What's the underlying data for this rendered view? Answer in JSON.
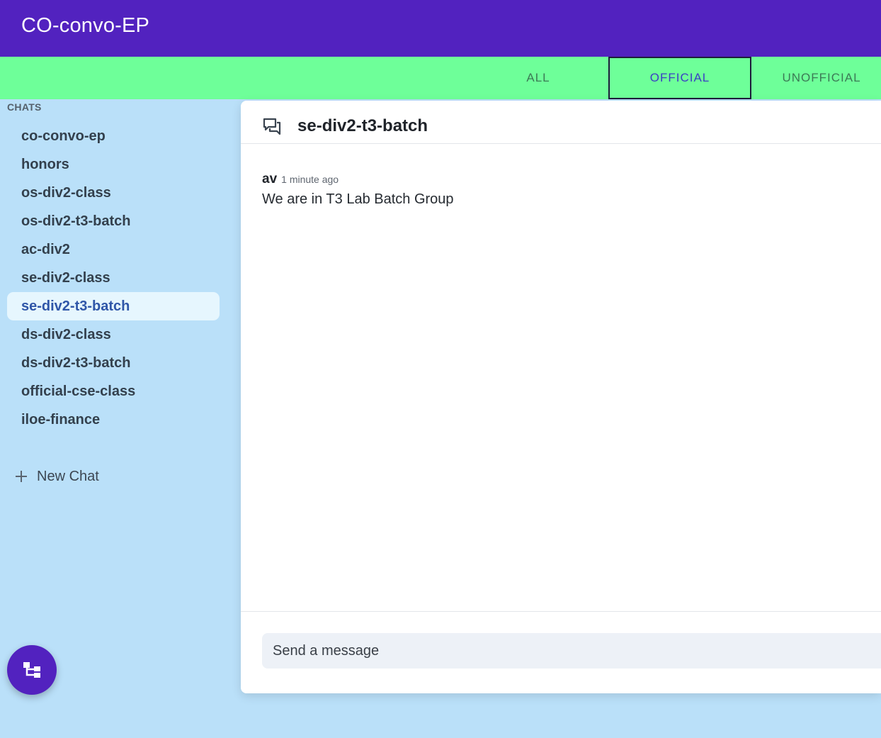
{
  "app": {
    "title": "CO-convo-EP"
  },
  "tabs": [
    {
      "label": "ALL"
    },
    {
      "label": "OFFICIAL",
      "selected": true
    },
    {
      "label": "UNOFFICIAL"
    }
  ],
  "sidebar": {
    "header": "CHATS",
    "items": [
      {
        "label": "co-convo-ep"
      },
      {
        "label": "honors"
      },
      {
        "label": "os-div2-class"
      },
      {
        "label": "os-div2-t3-batch"
      },
      {
        "label": "ac-div2"
      },
      {
        "label": "se-div2-class"
      },
      {
        "label": "se-div2-t3-batch",
        "active": true
      },
      {
        "label": "ds-div2-class"
      },
      {
        "label": "ds-div2-t3-batch"
      },
      {
        "label": "official-cse-class"
      },
      {
        "label": "iloe-finance"
      }
    ],
    "new_chat_label": "New Chat"
  },
  "chat": {
    "title": "se-div2-t3-batch",
    "messages": [
      {
        "author": "av",
        "time": "1 minute ago",
        "text": "We are in T3 Lab Batch Group"
      }
    ]
  },
  "composer": {
    "placeholder": "Send a message"
  },
  "colors": {
    "appbar": "#5222bf",
    "tabbar": "#6eff99",
    "sidebar_bg": "#bae0f9",
    "active_item_bg": "#e6f6fe",
    "active_item_text": "#2f56a8",
    "fab": "#5222bf"
  },
  "icons": {
    "chat_header": "chat-bubbles-icon",
    "new_chat": "plus-icon",
    "fab": "hierarchy-icon"
  }
}
